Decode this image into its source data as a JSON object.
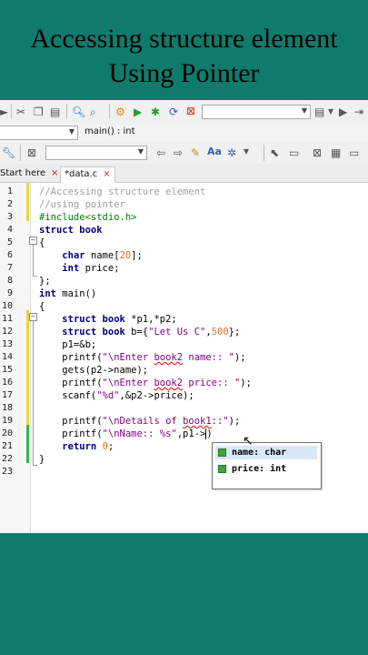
{
  "video_title": {
    "line1": "Accessing structure element",
    "line2": "Using Pointer"
  },
  "toolbar": {
    "function_dropdown": "main() : int"
  },
  "tabs": [
    {
      "label": "Start here",
      "close": "×"
    },
    {
      "label": "*data.c",
      "close": "×"
    }
  ],
  "line_numbers": [
    "1",
    "2",
    "3",
    "4",
    "5",
    "6",
    "7",
    "8",
    "9",
    "10",
    "11",
    "12",
    "13",
    "14",
    "15",
    "16",
    "17",
    "18",
    "19",
    "20",
    "21",
    "22",
    "23"
  ],
  "code": [
    {
      "seg": [
        {
          "c": "d",
          "t": "//Accessing structure element"
        }
      ]
    },
    {
      "seg": [
        {
          "c": "d",
          "t": "//using pointer"
        }
      ]
    },
    {
      "seg": [
        {
          "c": "pp",
          "t": "#include<stdio.h>"
        }
      ]
    },
    {
      "seg": [
        {
          "c": "k",
          "t": "struct book"
        }
      ]
    },
    {
      "seg": [
        {
          "c": "",
          "t": "{"
        }
      ]
    },
    {
      "seg": [
        {
          "c": "",
          "t": "    "
        },
        {
          "c": "k",
          "t": "char"
        },
        {
          "c": "",
          "t": " name["
        },
        {
          "c": "n",
          "t": "20"
        },
        {
          "c": "",
          "t": "];"
        }
      ]
    },
    {
      "seg": [
        {
          "c": "",
          "t": "    "
        },
        {
          "c": "k",
          "t": "int"
        },
        {
          "c": "",
          "t": " price;"
        }
      ]
    },
    {
      "seg": [
        {
          "c": "",
          "t": "};"
        }
      ]
    },
    {
      "seg": [
        {
          "c": "k",
          "t": "int"
        },
        {
          "c": "",
          "t": " main()"
        }
      ]
    },
    {
      "seg": [
        {
          "c": "",
          "t": "{"
        }
      ]
    },
    {
      "seg": [
        {
          "c": "",
          "t": "    "
        },
        {
          "c": "k",
          "t": "struct book"
        },
        {
          "c": "",
          "t": " *p1,*p2;"
        }
      ]
    },
    {
      "seg": [
        {
          "c": "",
          "t": "    "
        },
        {
          "c": "k",
          "t": "struct book"
        },
        {
          "c": "",
          "t": " b={"
        },
        {
          "c": "s",
          "t": "\"Let Us C\""
        },
        {
          "c": "",
          "t": ","
        },
        {
          "c": "n",
          "t": "500"
        },
        {
          "c": "",
          "t": "};"
        }
      ]
    },
    {
      "seg": [
        {
          "c": "",
          "t": "    p1=&b;"
        }
      ]
    },
    {
      "seg": [
        {
          "c": "",
          "t": "    printf("
        },
        {
          "c": "s",
          "t": "\"\\nEnter "
        },
        {
          "c": "s u",
          "t": "book2"
        },
        {
          "c": "s",
          "t": " name:: \""
        },
        {
          "c": "",
          "t": ");"
        }
      ]
    },
    {
      "seg": [
        {
          "c": "",
          "t": "    gets(p2->name);"
        }
      ]
    },
    {
      "seg": [
        {
          "c": "",
          "t": "    printf("
        },
        {
          "c": "s",
          "t": "\"\\nEnter "
        },
        {
          "c": "s u",
          "t": "book2"
        },
        {
          "c": "s",
          "t": " price:: \""
        },
        {
          "c": "",
          "t": ");"
        }
      ]
    },
    {
      "seg": [
        {
          "c": "",
          "t": "    scanf("
        },
        {
          "c": "s",
          "t": "\"%d\""
        },
        {
          "c": "",
          "t": ",&p2->price);"
        }
      ]
    },
    {
      "seg": [
        {
          "c": "",
          "t": ""
        }
      ]
    },
    {
      "seg": [
        {
          "c": "",
          "t": "    printf("
        },
        {
          "c": "s",
          "t": "\"\\nDetails of "
        },
        {
          "c": "s u",
          "t": "book1"
        },
        {
          "c": "s",
          "t": "::\""
        },
        {
          "c": "",
          "t": ");"
        }
      ]
    },
    {
      "seg": [
        {
          "c": "",
          "t": "    printf("
        },
        {
          "c": "s",
          "t": "\"\\nName:: %s\""
        },
        {
          "c": "",
          "t": ",p1->"
        },
        {
          "c": "caret",
          "t": ""
        },
        {
          "c": "",
          "t": ")"
        }
      ]
    },
    {
      "seg": [
        {
          "c": "",
          "t": "    "
        },
        {
          "c": "k",
          "t": "return"
        },
        {
          "c": "",
          "t": " "
        },
        {
          "c": "n",
          "t": "0"
        },
        {
          "c": "",
          "t": ";"
        }
      ]
    },
    {
      "seg": [
        {
          "c": "",
          "t": "}"
        }
      ]
    },
    {
      "seg": [
        {
          "c": "",
          "t": ""
        }
      ]
    }
  ],
  "autocomplete": [
    {
      "label": "name: char"
    },
    {
      "label": "price: int"
    }
  ],
  "colors": {
    "background": "#0f7b6c",
    "popup_icon": "#3ea43e"
  }
}
